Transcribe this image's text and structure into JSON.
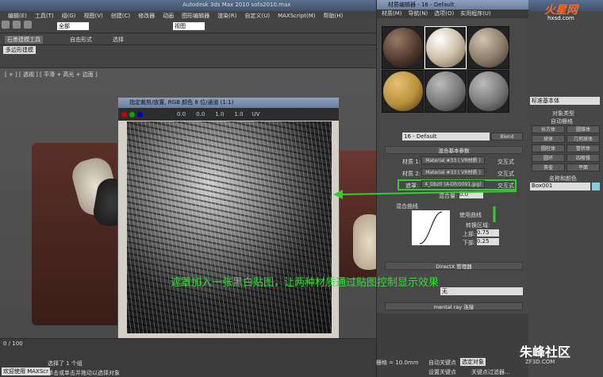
{
  "app": {
    "title": "Autodesk 3ds Max 2010    sofa2010.max"
  },
  "menus": [
    "编辑(E)",
    "工具(T)",
    "组(G)",
    "视图(V)",
    "创建(C)",
    "修改器",
    "动画",
    "图形编辑器",
    "渲染(R)",
    "自定义(U)",
    "MAXScript(M)",
    "帮助(H)"
  ],
  "toolbar": {
    "selection_filter": "全部",
    "view_dropdown": "视图"
  },
  "ribbon": {
    "tabs": [
      "石墨建模工具",
      "自由形式",
      "选择"
    ],
    "sub": "多边形建模"
  },
  "viewport": {
    "label": "[ + ] [ 透视 ] [ 平滑 + 高光 + 边面 ]",
    "timeline": "0 / 100"
  },
  "bitmap_window": {
    "title": "指定裁剪/放置, RGB 颜色 8 位/通道 (1:1)",
    "uv_label": "UV",
    "u": "0.0",
    "v": "0.0",
    "w": "1.0",
    "h": "1.0"
  },
  "mat_editor": {
    "title": "材质编辑器 - 16 - Default",
    "menus": [
      "材质(M)",
      "导航(N)",
      "选项(O)",
      "实用程序(U)"
    ],
    "material_name": "16 - Default",
    "type_button": "Blend",
    "rollout_basic": "混合基本参数",
    "mat1_label": "材质 1:",
    "mat1_value": "Material #33 ( VR材质 )",
    "mat2_label": "材质 2:",
    "mat2_value": "Material #33 ( VR材质 )",
    "mask_label": "遮罩:",
    "mask_value": "4_Dbz0 (A-Dfc0091.jpg)",
    "interactive": "交互式",
    "blend_amount_label": "混合量:",
    "blend_amount": "0.0",
    "curve_section": "混合曲线",
    "use_curve": "使用曲线",
    "transition": "转换区域:",
    "upper_label": "上部:",
    "upper": "0.75",
    "lower_label": "下部:",
    "lower": "0.25",
    "directx": "DirectX 管理器",
    "mental_ray": "mental ray 连接",
    "none_option": "无"
  },
  "right_panel": {
    "dropdown": "标准基本体",
    "group_type": "对象类型",
    "auto_grid": "自动栅格",
    "buttons": [
      "长方体",
      "圆锥体",
      "球体",
      "几何球体",
      "圆柱体",
      "管状体",
      "圆环",
      "四棱锥",
      "茶壶",
      "平面"
    ],
    "name_color": "名称和颜色",
    "object_name": "Box001"
  },
  "status": {
    "selected": "选择了 1 个组",
    "hint": "单击或单击并拖动以选择对象",
    "welcome": "欢迎使用 MAXScr",
    "grid": "栅格 = 10.0mm",
    "auto_key": "自动关键点",
    "select_obj": "选定对象",
    "set_key": "设置关键点",
    "filter": "关键点过滤器..."
  },
  "overlay_text": "遮罩加入一张黑白贴图，让两种材质通过贴图控制显示效果",
  "watermarks": {
    "top": "火星网",
    "top_sub": "hxsd.com",
    "bottom": "朱峰社区",
    "bottom_sub": "ZF3D.COM"
  }
}
